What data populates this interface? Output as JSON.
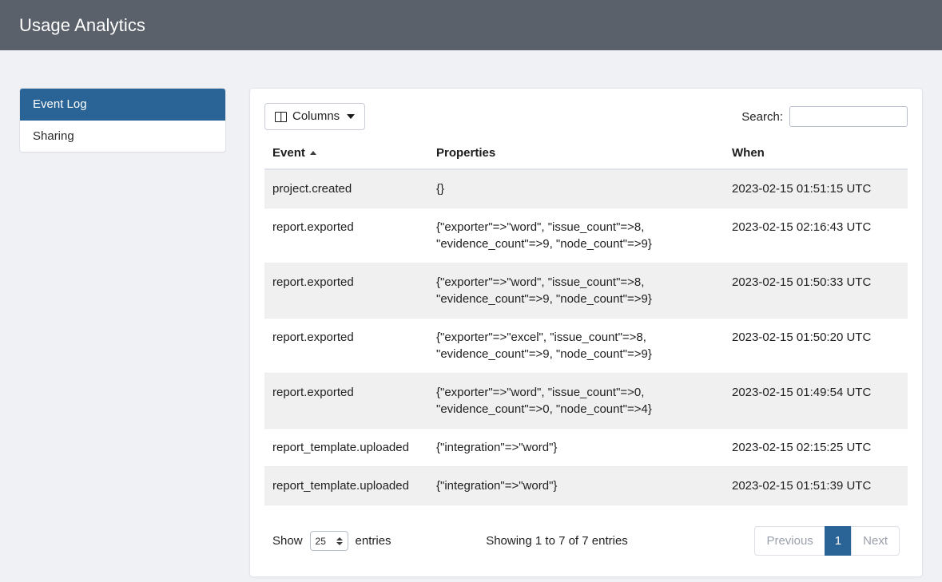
{
  "header": {
    "title": "Usage Analytics"
  },
  "sidebar": {
    "items": [
      {
        "label": "Event Log",
        "active": true
      },
      {
        "label": "Sharing",
        "active": false
      }
    ]
  },
  "toolbar": {
    "columns_label": "Columns",
    "columns_icon": "table-columns-icon",
    "caret_icon": "chevron-down-icon",
    "search_label": "Search:",
    "search_value": "",
    "search_placeholder": ""
  },
  "table": {
    "columns": [
      {
        "label": "Event",
        "sort": "asc"
      },
      {
        "label": "Properties",
        "sort": null
      },
      {
        "label": "When",
        "sort": null
      }
    ],
    "rows": [
      {
        "event": "project.created",
        "properties": [
          "{}"
        ],
        "when": "2023-02-15 01:51:15 UTC",
        "striped": true
      },
      {
        "event": "report.exported",
        "properties": [
          "{\"exporter\"=>\"word\", \"issue_count\"=>8,",
          "\"evidence_count\"=>9, \"node_count\"=>9}"
        ],
        "when": "2023-02-15 02:16:43 UTC",
        "striped": false
      },
      {
        "event": "report.exported",
        "properties": [
          "{\"exporter\"=>\"word\", \"issue_count\"=>8,",
          "\"evidence_count\"=>9, \"node_count\"=>9}"
        ],
        "when": "2023-02-15 01:50:33 UTC",
        "striped": true
      },
      {
        "event": "report.exported",
        "properties": [
          "{\"exporter\"=>\"excel\", \"issue_count\"=>8,",
          "\"evidence_count\"=>9, \"node_count\"=>9}"
        ],
        "when": "2023-02-15 01:50:20 UTC",
        "striped": false
      },
      {
        "event": "report.exported",
        "properties": [
          "{\"exporter\"=>\"word\", \"issue_count\"=>0,",
          "\"evidence_count\"=>0, \"node_count\"=>4}"
        ],
        "when": "2023-02-15 01:49:54 UTC",
        "striped": true
      },
      {
        "event": "report_template.uploaded",
        "properties": [
          "{\"integration\"=>\"word\"}"
        ],
        "when": "2023-02-15 02:15:25 UTC",
        "striped": false
      },
      {
        "event": "report_template.uploaded",
        "properties": [
          "{\"integration\"=>\"word\"}"
        ],
        "when": "2023-02-15 01:51:39 UTC",
        "striped": true
      }
    ]
  },
  "footer": {
    "show_label": "Show",
    "entries_label": "entries",
    "page_length": "25",
    "page_length_options": [
      "10",
      "25",
      "50",
      "100"
    ],
    "info": "Showing 1 to 7 of 7 entries",
    "pagination": [
      {
        "label": "Previous",
        "state": "disabled"
      },
      {
        "label": "1",
        "state": "current"
      },
      {
        "label": "Next",
        "state": "disabled"
      }
    ]
  },
  "colors": {
    "appbar": "#5b616b",
    "accent": "#2a6496",
    "page_bg": "#eff1f5",
    "stripe": "#f0f0f0"
  }
}
